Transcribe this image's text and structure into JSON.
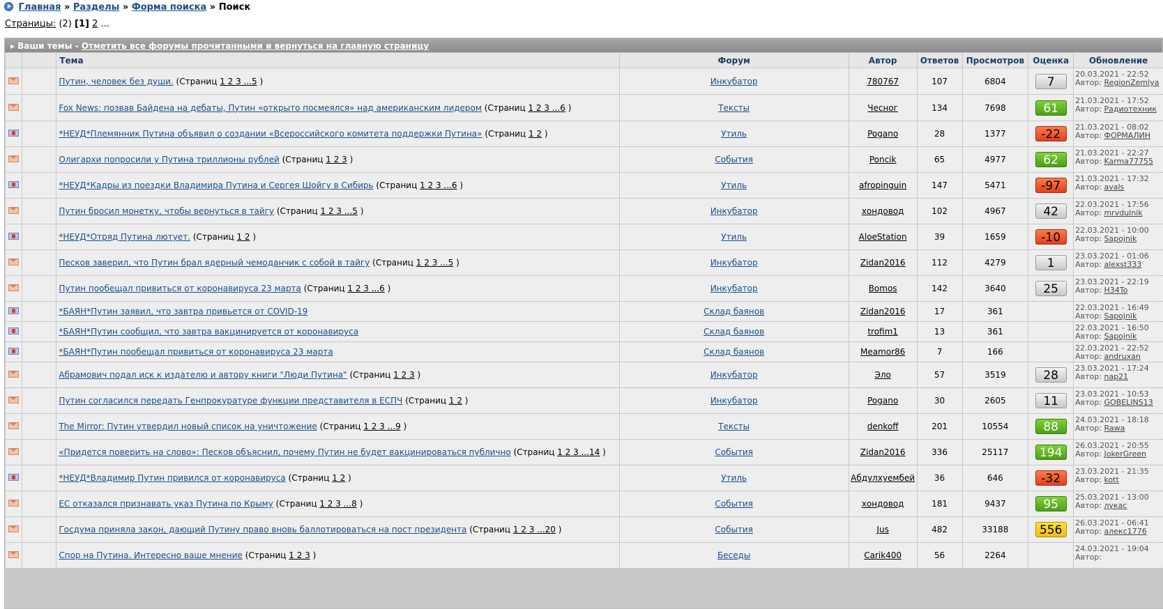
{
  "breadcrumb": {
    "items": [
      "Главная",
      "Разделы",
      "Форма поиска"
    ],
    "separator": "»",
    "current": "Поиск"
  },
  "pages": {
    "label": "Страницы:",
    "count": "(2)",
    "current": "[1]",
    "next": "2",
    "more": "..."
  },
  "header": {
    "title": "Ваши темы",
    "dash": " - ",
    "mark_all_read": "Отметить все форумы прочитанными и вернуться на главную страницу"
  },
  "columns": [
    "Тема",
    "Форум",
    "Автор",
    "Ответов",
    "Просмотров",
    "Оценка",
    "Обновление"
  ],
  "colors": {
    "link": "#1b4f8a",
    "header_bar": "#9a9a9a",
    "row_bg": "#eeeeee",
    "rating_green": "#5aad1e",
    "rating_red": "#f05a2e",
    "rating_yellow": "#f7cc1c",
    "rating_grey": "#dcdcdc"
  },
  "rows": [
    {
      "icon": "envelope-icon",
      "title": "Путин, человек без души.",
      "pages": "1 2 3 ...5",
      "forum": "Инкубатор",
      "author": "780767",
      "replies": "107",
      "views": "6804",
      "rating": "7",
      "rating_color": "grey",
      "date": "20.03.2021 - 22:52",
      "last_author": "RegionZemlya"
    },
    {
      "icon": "envelope-icon",
      "title": "Fox News: позвав Байдена на дебаты, Путин «открыто посмеялся» над американским лидером",
      "pages": "1 2 3 ...6",
      "forum": "Тексты",
      "author": "Чесног",
      "replies": "134",
      "views": "7698",
      "rating": "61",
      "rating_color": "green",
      "date": "21.03.2021 - 17:52",
      "last_author": "Радиотехник"
    },
    {
      "icon": "locked-icon",
      "title": "*НЕУД*Племянник Путина объявил о создании «Всероссийского комитета поддержки Путина»",
      "pages": "1 2",
      "forum": "Утиль",
      "author": "Pogano",
      "replies": "28",
      "views": "1377",
      "rating": "-22",
      "rating_color": "red",
      "date": "21.03.2021 - 08:02",
      "last_author": "ФОРМАЛИН"
    },
    {
      "icon": "envelope-icon",
      "title": "Олигархи попросили у Путина триллионы рублей",
      "pages": "1 2 3",
      "forum": "События",
      "author": "Poncik",
      "replies": "65",
      "views": "4977",
      "rating": "62",
      "rating_color": "green",
      "date": "21.03.2021 - 22:27",
      "last_author": "Karma77755"
    },
    {
      "icon": "locked-icon",
      "title": "*НЕУД*Кадры из поездки Владимира Путина и Сергея Шойгу в Сибирь",
      "pages": "1 2 3 ...6",
      "forum": "Утиль",
      "author": "afropinguin",
      "replies": "147",
      "views": "5471",
      "rating": "-97",
      "rating_color": "red",
      "date": "21.03.2021 - 17:32",
      "last_author": "avals"
    },
    {
      "icon": "envelope-icon",
      "title": "Путин бросил монетку, чтобы вернуться в тайгу",
      "pages": "1 2 3 ...5",
      "forum": "Инкубатор",
      "author": "хондовод",
      "replies": "102",
      "views": "4967",
      "rating": "42",
      "rating_color": "grey",
      "date": "22.03.2021 - 17:56",
      "last_author": "mrvdulnik"
    },
    {
      "icon": "locked-icon",
      "title": "*НЕУД*Отряд Путина лютует.",
      "pages": "1 2",
      "forum": "Утиль",
      "author": "AloeStation",
      "replies": "39",
      "views": "1659",
      "rating": "-10",
      "rating_color": "red",
      "date": "22.03.2021 - 10:00",
      "last_author": "Sapojnik"
    },
    {
      "icon": "envelope-icon",
      "title": "Песков заверил, что Путин брал ядерный чемоданчик с собой в тайгу",
      "pages": "1 2 3 ...5",
      "forum": "Инкубатор",
      "author": "Zidan2016",
      "replies": "112",
      "views": "4279",
      "rating": "1",
      "rating_color": "grey",
      "date": "23.03.2021 - 01:06",
      "last_author": "alexst333"
    },
    {
      "icon": "envelope-icon",
      "title": "Путин пообещал привиться от коронавируса 23 марта",
      "pages": "1 2 3 ...6",
      "forum": "Инкубатор",
      "author": "Bomos",
      "replies": "142",
      "views": "3640",
      "rating": "25",
      "rating_color": "grey",
      "date": "23.03.2021 - 22:19",
      "last_author": "H34To"
    },
    {
      "icon": "locked-icon",
      "title": "*БАЯН*Путин заявил, что завтра привьется от COVID-19",
      "pages": "",
      "forum": "Склад баянов",
      "author": "Zidan2016",
      "replies": "17",
      "views": "361",
      "rating": "",
      "rating_color": "",
      "date": "22.03.2021 - 16:49",
      "last_author": "Sapojnik"
    },
    {
      "icon": "locked-icon",
      "title": "*БАЯН*Путин сообщил, что завтра вакцинируется от коронавируса",
      "pages": "",
      "forum": "Склад баянов",
      "author": "trofim1",
      "replies": "13",
      "views": "361",
      "rating": "",
      "rating_color": "",
      "date": "22.03.2021 - 16:50",
      "last_author": "Sapojnik"
    },
    {
      "icon": "locked-icon",
      "title": "*БАЯН*Путин пообещал привиться от коронавируса 23 марта",
      "pages": "",
      "forum": "Склад баянов",
      "author": "Meamor86",
      "replies": "7",
      "views": "166",
      "rating": "",
      "rating_color": "",
      "date": "22.03.2021 - 22:52",
      "last_author": "andruxan"
    },
    {
      "icon": "envelope-icon",
      "title": "Абрамович подал иск к издателю и автору книги \"Люди Путина\"",
      "pages": "1 2 3",
      "forum": "Инкубатор",
      "author": "Эло",
      "replies": "57",
      "views": "3519",
      "rating": "28",
      "rating_color": "grey",
      "date": "23.03.2021 - 17:24",
      "last_author": "nap21"
    },
    {
      "icon": "envelope-icon",
      "title": "Путин согласился передать Генпрокуратуре функции представителя в ЕСПЧ",
      "pages": "1 2",
      "forum": "Инкубатор",
      "author": "Pogano",
      "replies": "30",
      "views": "2605",
      "rating": "11",
      "rating_color": "grey",
      "date": "23.03.2021 - 10:53",
      "last_author": "GOBELINS13"
    },
    {
      "icon": "envelope-icon",
      "title": "The Mirror: Путин утвердил новый список на уничтожение",
      "pages": "1 2 3 ...9",
      "forum": "Тексты",
      "author": "denkoff",
      "replies": "201",
      "views": "10554",
      "rating": "88",
      "rating_color": "green",
      "date": "24.03.2021 - 18:18",
      "last_author": "Rawa"
    },
    {
      "icon": "envelope-icon",
      "title": "«Придется поверить на слово»: Песков объяснил, почему Путин не будет вакцинироваться публично",
      "pages": "1 2 3 ...14",
      "forum": "События",
      "author": "Zidan2016",
      "replies": "336",
      "views": "25117",
      "rating": "194",
      "rating_color": "green",
      "date": "26.03.2021 - 20:55",
      "last_author": "JokerGreen"
    },
    {
      "icon": "locked-icon",
      "title": "*НЕУД*Владимир Путин привился от коронавируса",
      "pages": "1 2",
      "forum": "Утиль",
      "author": "Абдулхуембей",
      "replies": "36",
      "views": "646",
      "rating": "-32",
      "rating_color": "red",
      "date": "23.03.2021 - 21:35",
      "last_author": "kott"
    },
    {
      "icon": "envelope-icon",
      "title": "ЕС отказался признавать указ Путина по Крыму",
      "pages": "1 2 3 ...8",
      "forum": "События",
      "author": "хондовод",
      "replies": "181",
      "views": "9437",
      "rating": "95",
      "rating_color": "green",
      "date": "25.03.2021 - 13:00",
      "last_author": "лукас"
    },
    {
      "icon": "envelope-icon",
      "title": "Госдума приняла закон, дающий Путину право вновь баллотироваться на пост президента",
      "pages": "1 2 3 ...20",
      "forum": "События",
      "author": "Jus",
      "replies": "482",
      "views": "33188",
      "rating": "556",
      "rating_color": "yellow",
      "date": "26.03.2021 - 06:41",
      "last_author": "алекс1776"
    },
    {
      "icon": "envelope-icon",
      "title": "Спор на Путина. Интересно ваше мнение",
      "pages": "1 2 3",
      "forum": "Беседы",
      "author": "Carik400",
      "replies": "56",
      "views": "2264",
      "rating": "",
      "rating_color": "",
      "date": "24.03.2021 - 19:04",
      "last_author": ""
    }
  ],
  "labels": {
    "pages_prefix": "(Страниц ",
    "pages_suffix": ")",
    "author_prefix": "Автор: "
  }
}
